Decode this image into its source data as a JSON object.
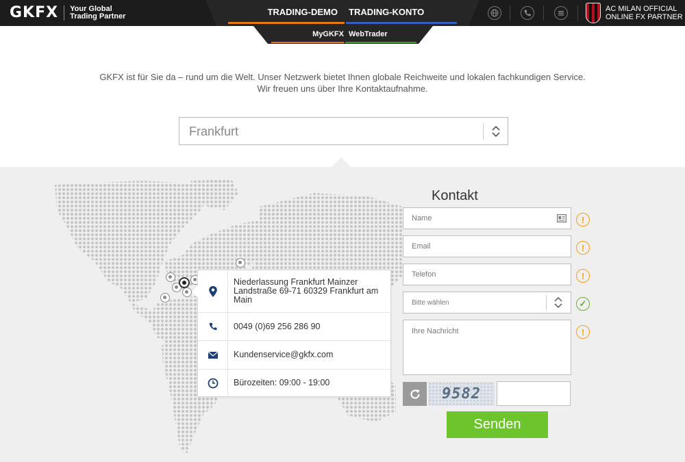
{
  "header": {
    "logo": "GKFX",
    "tagline_line1": "Your Global",
    "tagline_line2": "Trading Partner",
    "nav_demo": "TRADING-DEMO",
    "nav_konto": "TRADING-KONTO",
    "nav_mygkfx": "MyGKFX",
    "nav_webtrader": "WebTrader",
    "partner_line1": "AC MILAN OFFICIAL",
    "partner_line2": "ONLINE FX PARTNER",
    "icons": [
      "globe-icon",
      "phone-icon",
      "menu-icon"
    ],
    "accent_orange": "#e07b1a",
    "accent_blue": "#2f64b8",
    "accent_green": "#4e9a2e"
  },
  "intro": {
    "line1": "GKFX ist für Sie da – rund um die Welt. Unser Netzwerk bietet Ihnen globale Reichweite und lokalen fachkundigen Service.",
    "line2": "Wir freuen uns über Ihre Kontaktaufnahme."
  },
  "city_select": {
    "value": "Frankfurt"
  },
  "office": {
    "address": "Niederlassung Frankfurt Mainzer Landstraße 69-71 60329 Frankfurt am Main",
    "phone": "0049 (0)69 256 286 90",
    "email": "Kundenservice@gkfx.com",
    "hours": "Bürozeiten: 09:00 - 19:00"
  },
  "contact": {
    "title": "Kontakt",
    "name_placeholder": "Name",
    "email_placeholder": "Email",
    "phone_placeholder": "Telefon",
    "select_placeholder": "Bitte wählen",
    "message_placeholder": "Ihre Nachricht",
    "captcha_code": "9582",
    "submit_label": "Senden",
    "status_warning_symbol": "!",
    "status_ok_symbol": "✓",
    "submit_color": "#6cc52c"
  }
}
